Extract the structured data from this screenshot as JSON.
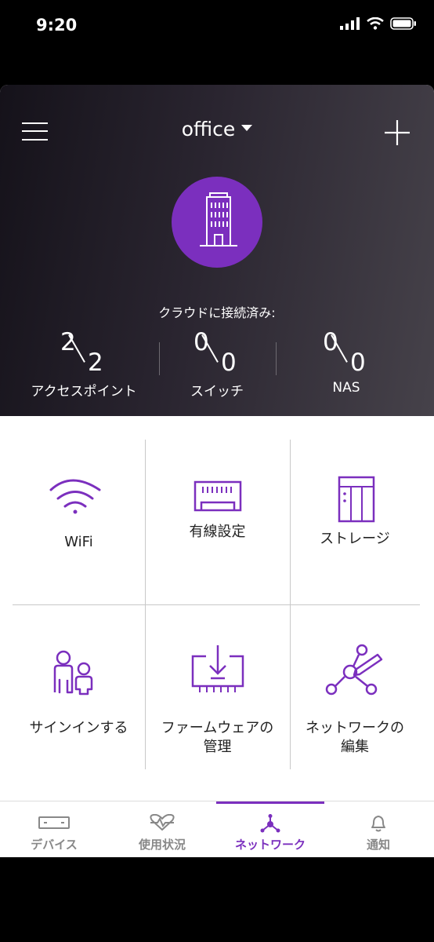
{
  "status_bar": {
    "time": "9:20"
  },
  "header": {
    "location": "office",
    "cloud_label": "クラウドに接続済み:",
    "stats": [
      {
        "connected": "2",
        "total": "2",
        "label": "アクセスポイント"
      },
      {
        "connected": "0",
        "total": "0",
        "label": "スイッチ"
      },
      {
        "connected": "0",
        "total": "0",
        "label": "NAS"
      }
    ]
  },
  "grid": [
    {
      "label": "WiFi",
      "icon": "wifi-icon"
    },
    {
      "label": "有線設定",
      "icon": "ethernet-port-icon"
    },
    {
      "label": "ストレージ",
      "icon": "storage-icon"
    },
    {
      "label": "サインインする",
      "icon": "users-icon"
    },
    {
      "label_line1": "ファームウェアの",
      "label_line2": "管理",
      "icon": "firmware-download-icon"
    },
    {
      "label_line1": "ネットワークの",
      "label_line2": "編集",
      "icon": "network-edit-icon"
    }
  ],
  "tabs": [
    {
      "label": "デバイス",
      "icon": "device-icon"
    },
    {
      "label": "使用状況",
      "icon": "heartbeat-icon"
    },
    {
      "label": "ネットワーク",
      "icon": "network-icon"
    },
    {
      "label": "通知",
      "icon": "bell-icon"
    }
  ],
  "colors": {
    "accent": "#7b2fbe",
    "header_dark": "#15121a",
    "header_light": "#46424a"
  }
}
